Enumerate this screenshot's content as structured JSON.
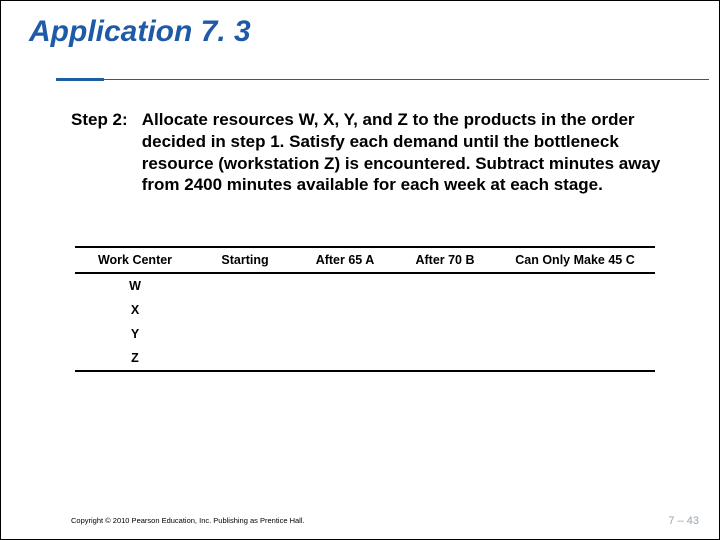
{
  "title": "Application 7. 3",
  "step": {
    "label": "Step 2:",
    "text": "Allocate resources W, X, Y, and Z to the products in the order decided in step 1. Satisfy each demand until the bottleneck resource (workstation Z) is encountered. Subtract minutes away from 2400 minutes available for each week at each stage."
  },
  "chart_data": {
    "type": "table",
    "columns": [
      "Work Center",
      "Starting",
      "After 65 A",
      "After 70 B",
      "Can Only Make 45 C"
    ],
    "rows": [
      {
        "wc": "W",
        "starting": "",
        "afterA": "",
        "afterB": "",
        "afterC": ""
      },
      {
        "wc": "X",
        "starting": "",
        "afterA": "",
        "afterB": "",
        "afterC": ""
      },
      {
        "wc": "Y",
        "starting": "",
        "afterA": "",
        "afterB": "",
        "afterC": ""
      },
      {
        "wc": "Z",
        "starting": "",
        "afterA": "",
        "afterB": "",
        "afterC": ""
      }
    ]
  },
  "copyright": "Copyright © 2010 Pearson Education, Inc. Publishing as Prentice Hall.",
  "pagenum": "7 – 43"
}
